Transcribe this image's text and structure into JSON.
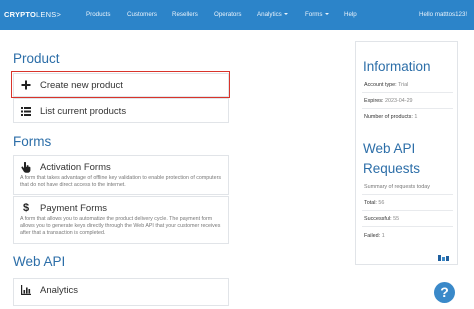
{
  "navbar": {
    "brand_bold": "CRYPTO",
    "brand_light": "LENS>",
    "items": [
      {
        "label": "Products"
      },
      {
        "label": "Customers"
      },
      {
        "label": "Resellers"
      },
      {
        "label": "Operators"
      },
      {
        "label": "Analytics",
        "dropdown": true
      },
      {
        "label": "Forms",
        "dropdown": true
      },
      {
        "label": "Help"
      }
    ],
    "user_label": "Hello matttos123!"
  },
  "product_section": {
    "title": "Product",
    "items": [
      {
        "label": "Create new product",
        "icon": "plus-icon"
      },
      {
        "label": "List current products",
        "icon": "list-icon"
      }
    ]
  },
  "forms_section": {
    "title": "Forms",
    "items": [
      {
        "label": "Activation Forms",
        "icon": "hand-pointer-icon",
        "description": "A form that takes advantage of offline key validation to enable protection of computers that do not have direct access to the internet."
      },
      {
        "label": "Payment Forms",
        "icon": "dollar-icon",
        "description": "A form that allows you to automatize the product delivery cycle. The payment form allows you to generate keys directly through the Web API that your customer receives after that a transaction is completed."
      }
    ]
  },
  "webapi_section": {
    "title": "Web API",
    "items": [
      {
        "label": "Analytics",
        "icon": "bar-chart-icon"
      }
    ]
  },
  "info_panel": {
    "title": "Information",
    "account_type_label": "Account type:",
    "account_type_value": "Trial",
    "expires_label": "Expires:",
    "expires_value": "2023-04-29",
    "products_label": "Number of products:",
    "products_value": "1",
    "api_title_1": "Web API",
    "api_title_2": "Requests",
    "summary": "Summary of requests today",
    "total_label": "Total:",
    "total_value": "56",
    "successful_label": "Successful:",
    "successful_value": "55",
    "failed_label": "Failed:",
    "failed_value": "1"
  },
  "help_button": "?",
  "colors": {
    "navbar": "#2c84c9",
    "heading": "#2c6ea8",
    "highlight": "#d9342b"
  }
}
